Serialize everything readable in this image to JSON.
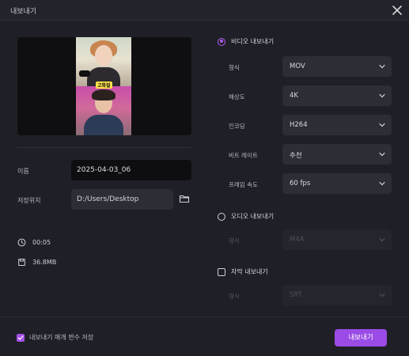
{
  "window": {
    "title": "내보내기"
  },
  "left": {
    "name_label": "이름",
    "name_value": "2025-04-03_06",
    "location_label": "저장위치",
    "location_value": "D:/Users/Desktop",
    "caption_text": "고화질",
    "duration": "00:05",
    "size": "36.8MB"
  },
  "video": {
    "section_label": "비디오 내보내기",
    "format_label": "형식",
    "format_value": "MOV",
    "resolution_label": "해상도",
    "resolution_value": "4K",
    "encoding_label": "인코딩",
    "encoding_value": "H264",
    "bitrate_label": "비트 레이트",
    "bitrate_value": "추천",
    "framerate_label": "프레임 속도",
    "framerate_value": "60  fps"
  },
  "audio": {
    "section_label": "오디오 내보내기",
    "format_label": "형식",
    "format_value": "M4A"
  },
  "subtitle": {
    "section_label": "자막 내보내기",
    "format_label": "형식",
    "format_value": "SRT"
  },
  "footer": {
    "remember_label": "내보내기 매개 변수 저장",
    "export_button": "내보내기"
  },
  "colors": {
    "accent": "#9b4be6",
    "background": "#1f2027",
    "field": "#2c2d35"
  },
  "icons": [
    "close-icon",
    "folder-icon",
    "clock-icon",
    "file-size-icon",
    "chevron-down-icon",
    "check-icon"
  ]
}
